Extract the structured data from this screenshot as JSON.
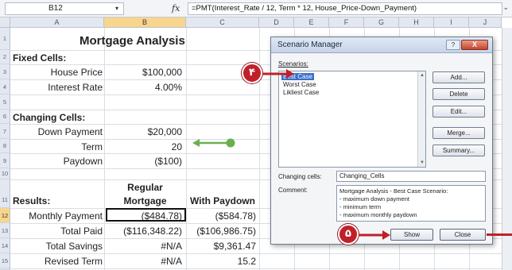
{
  "formula_bar": {
    "name_box": "B12",
    "fx": "fx",
    "formula": "=PMT(Interest_Rate / 12, Term * 12, House_Price-Down_Payment)"
  },
  "columns": [
    "A",
    "B",
    "C",
    "D",
    "E",
    "F",
    "G",
    "H",
    "I",
    "J"
  ],
  "rows": [
    "1",
    "2",
    "3",
    "4",
    "5",
    "6",
    "7",
    "8",
    "9",
    "10",
    "11",
    "12",
    "13",
    "14",
    "15",
    "16"
  ],
  "sheet": {
    "title": "Mortgage Analysis",
    "fixed_cells_label": "Fixed Cells:",
    "house_price_label": "House Price",
    "house_price_value": "$100,000",
    "interest_rate_label": "Interest Rate",
    "interest_rate_value": "4.00%",
    "changing_cells_label": "Changing Cells:",
    "down_payment_label": "Down Payment",
    "down_payment_value": "$20,000",
    "term_label": "Term",
    "term_value": "20",
    "paydown_label": "Paydown",
    "paydown_value": "($100)",
    "regular_header_1": "Regular",
    "regular_header_2": "Mortgage",
    "with_paydown_header": "With Paydown",
    "results_label": "Results:",
    "monthly_payment_label": "Monthly Payment",
    "monthly_payment_regular": "($484.78)",
    "monthly_payment_paydown": "($584.78)",
    "total_paid_label": "Total Paid",
    "total_paid_regular": "($116,348.22)",
    "total_paid_paydown": "($106,986.75)",
    "total_savings_label": "Total Savings",
    "total_savings_regular": "#N/A",
    "total_savings_paydown": "$9,361.47",
    "revised_term_label": "Revised Term",
    "revised_term_regular": "#N/A",
    "revised_term_paydown": "15.2"
  },
  "dialog": {
    "title": "Scenario Manager",
    "help_button": "?",
    "close_x": "X",
    "scenarios_label": "Scenarios:",
    "scenarios": [
      "Best Case",
      "Worst Case",
      "Likliest Case"
    ],
    "buttons": {
      "add": "Add...",
      "delete": "Delete",
      "edit": "Edit...",
      "merge": "Merge...",
      "summary": "Summary...",
      "show": "Show",
      "close": "Close"
    },
    "changing_cells_label": "Changing cells:",
    "changing_cells_value": "Changing_Cells",
    "comment_label": "Comment:",
    "comment_lines": [
      "Mortgage Analysis - Best Case Scenario:",
      " - maximum down payment",
      " - minimum term",
      " - maximum monthly paydown"
    ]
  },
  "callouts": {
    "step_4": "۴",
    "step_5": "۵"
  },
  "colors": {
    "callout_red": "#c0202a",
    "arrow_green": "#6ab04c",
    "selection_blue": "#3a6fc9"
  }
}
